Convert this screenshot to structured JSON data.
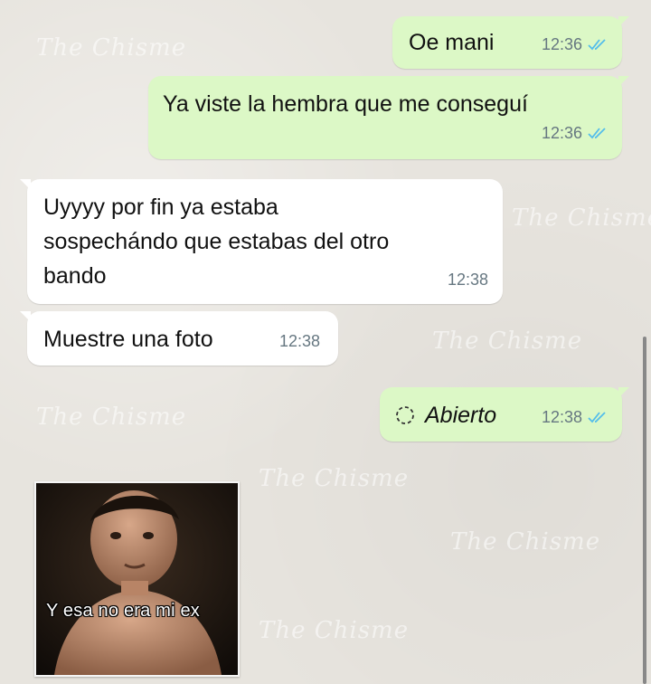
{
  "watermark_text": "The Chisme",
  "messages": [
    {
      "direction": "out",
      "text": "Oe mani",
      "time": "12:36",
      "status_icon": "double-check-read-icon"
    },
    {
      "direction": "out",
      "text": "Ya viste la hembra que me conseguí",
      "time": "12:36",
      "status_icon": "double-check-read-icon"
    },
    {
      "direction": "in",
      "lines": [
        "Uyyyy por fin ya estaba",
        "sospechándo que estabas del otro",
        "bando"
      ],
      "time": "12:38"
    },
    {
      "direction": "in",
      "text": "Muestre una foto",
      "time": "12:38"
    },
    {
      "direction": "out",
      "text": "Abierto",
      "prefix_icon": "view-once-opened-icon",
      "time": "12:38",
      "status_icon": "double-check-read-icon"
    }
  ],
  "sticker": {
    "caption": "Y esa no era mi ex"
  },
  "colors": {
    "outgoing_bubble": "#dcf8c6",
    "incoming_bubble": "#ffffff",
    "read_ticks": "#53bdeb",
    "meta_text": "#667781"
  }
}
